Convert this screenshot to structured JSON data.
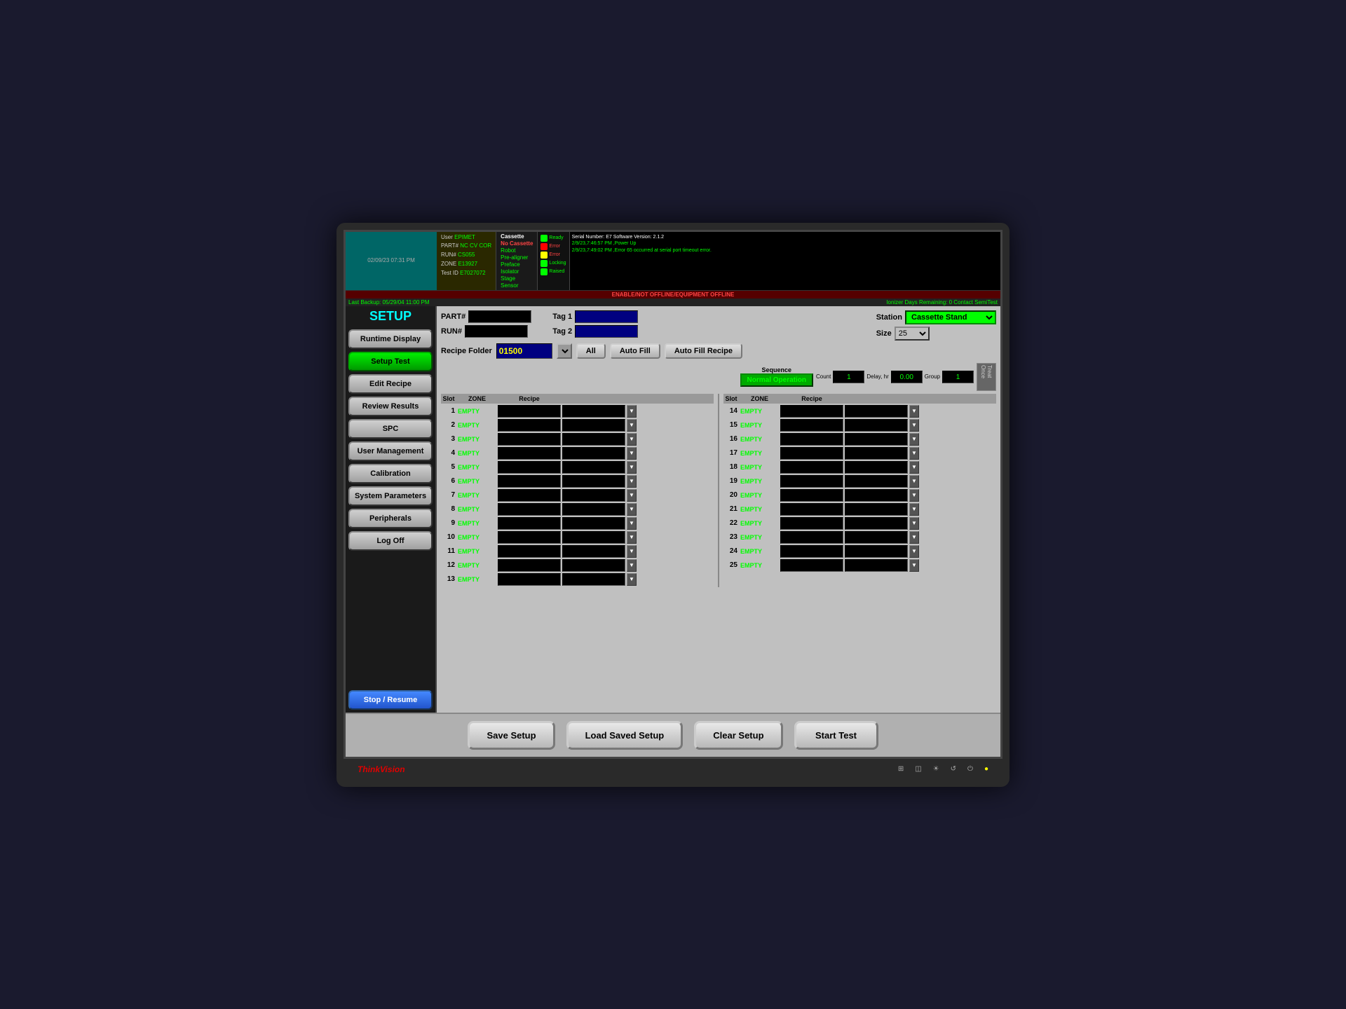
{
  "monitor": {
    "brand": "ThinkVision"
  },
  "header": {
    "datetime": "02/09/23 07:31 PM",
    "serial": "Serial Number: E7  Software Version: 2.1.2",
    "backup": "Last Backup: 05/29/04 11:00 PM",
    "ionizer": "Ionizer Days Remaining: 0 Contact SemiTest",
    "offline_banner": "ENABLE/NOT OFFLINE/EQUIPMENT OFFLINE",
    "info": {
      "user": "User",
      "user_val": "EPIMET",
      "part": "PART#",
      "part_val": "NC CV COR",
      "run": "RUN#",
      "run_val": "CS055",
      "zone": "ZONE",
      "zone_val": "E13927",
      "testid": "Test ID",
      "testid_val": "E7027072"
    },
    "cassette": {
      "label": "Cassette",
      "val": "No Cassette",
      "robot": "Robot",
      "prealigner": "Pre-aligner",
      "preface": "Preface",
      "isolator": "Isolator",
      "stage": "Stage",
      "sensor": "Sensor",
      "raised": "Raised",
      "error": "Error",
      "ready": "Ready",
      "error2": "Error",
      "locking": "Locking"
    },
    "log_lines": [
      "2/9/23,7:46:57 PM ,Power Up",
      "2/9/23,7:49:02 PM ,Error 65 occurred at serial port timeout error."
    ]
  },
  "sidebar": {
    "title": "SETUP",
    "items": [
      {
        "label": "Runtime Display",
        "active": false,
        "blue": false
      },
      {
        "label": "Setup Test",
        "active": true,
        "blue": false
      },
      {
        "label": "Edit Recipe",
        "active": false,
        "blue": false
      },
      {
        "label": "Review Results",
        "active": false,
        "blue": false
      },
      {
        "label": "SPC",
        "active": false,
        "blue": false
      },
      {
        "label": "User Management",
        "active": false,
        "blue": false
      },
      {
        "label": "Calibration",
        "active": false,
        "blue": false
      },
      {
        "label": "System Parameters",
        "active": false,
        "blue": false
      },
      {
        "label": "Peripherals",
        "active": false,
        "blue": false
      },
      {
        "label": "Log Off",
        "active": false,
        "blue": false
      },
      {
        "label": "Stop / Resume",
        "active": false,
        "blue": true
      }
    ]
  },
  "main": {
    "part_label": "PART#",
    "run_label": "RUN#",
    "tag1_label": "Tag 1",
    "tag2_label": "Tag 2",
    "station_label": "Station",
    "station_value": "Cassette Stand",
    "size_label": "Size",
    "size_value": "25",
    "recipe_folder_label": "Recipe Folder",
    "recipe_folder_value": "01500",
    "btn_all": "All",
    "btn_auto_fill": "Auto Fill",
    "btn_auto_fill_recipe": "Auto Fill Recipe",
    "sequence_label": "Sequence",
    "sequence_value": "Normal Operation",
    "count_label": "Count",
    "count_value": "1",
    "delay_label": "Delay, hr",
    "delay_value": "0.00",
    "group_label": "Group",
    "group_value": "1",
    "treat_once": "Treat Once",
    "col_slot": "Slot",
    "col_zone": "ZONE",
    "col_recipe": "Recipe",
    "left_slots": [
      {
        "num": "1",
        "empty": "EMPTY"
      },
      {
        "num": "2",
        "empty": "EMPTY"
      },
      {
        "num": "3",
        "empty": "EMPTY"
      },
      {
        "num": "4",
        "empty": "EMPTY"
      },
      {
        "num": "5",
        "empty": "EMPTY"
      },
      {
        "num": "6",
        "empty": "EMPTY"
      },
      {
        "num": "7",
        "empty": "EMPTY"
      },
      {
        "num": "8",
        "empty": "EMPTY"
      },
      {
        "num": "9",
        "empty": "EMPTY"
      },
      {
        "num": "10",
        "empty": "EMPTY"
      },
      {
        "num": "11",
        "empty": "EMPTY"
      },
      {
        "num": "12",
        "empty": "EMPTY"
      },
      {
        "num": "13",
        "empty": "EMPTY"
      }
    ],
    "right_slots": [
      {
        "num": "14",
        "empty": "EMPTY"
      },
      {
        "num": "15",
        "empty": "EMPTY"
      },
      {
        "num": "16",
        "empty": "EMPTY"
      },
      {
        "num": "17",
        "empty": "EMPTY"
      },
      {
        "num": "18",
        "empty": "EMPTY"
      },
      {
        "num": "19",
        "empty": "EMPTY"
      },
      {
        "num": "20",
        "empty": "EMPTY"
      },
      {
        "num": "21",
        "empty": "EMPTY"
      },
      {
        "num": "22",
        "empty": "EMPTY"
      },
      {
        "num": "23",
        "empty": "EMPTY"
      },
      {
        "num": "24",
        "empty": "EMPTY"
      },
      {
        "num": "25",
        "empty": "EMPTY"
      }
    ],
    "btn_save": "Save Setup",
    "btn_load": "Load Saved Setup",
    "btn_clear": "Clear Setup",
    "btn_start": "Start Test"
  }
}
